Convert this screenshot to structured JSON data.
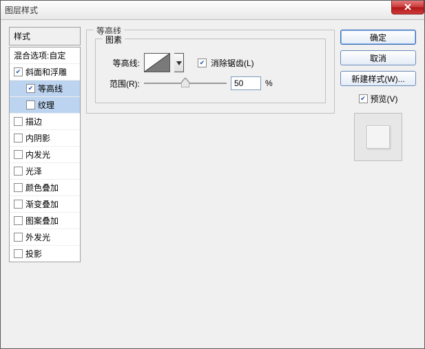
{
  "window": {
    "title": "图层样式"
  },
  "left": {
    "header": "样式",
    "items": [
      {
        "label": "混合选项:自定",
        "checked": null,
        "sub": false,
        "selected": false
      },
      {
        "label": "斜面和浮雕",
        "checked": true,
        "sub": false,
        "selected": false
      },
      {
        "label": "等高线",
        "checked": true,
        "sub": true,
        "selected": true
      },
      {
        "label": "纹理",
        "checked": false,
        "sub": true,
        "selected": true
      },
      {
        "label": "描边",
        "checked": false,
        "sub": false,
        "selected": false
      },
      {
        "label": "内阴影",
        "checked": false,
        "sub": false,
        "selected": false
      },
      {
        "label": "内发光",
        "checked": false,
        "sub": false,
        "selected": false
      },
      {
        "label": "光泽",
        "checked": false,
        "sub": false,
        "selected": false
      },
      {
        "label": "颜色叠加",
        "checked": false,
        "sub": false,
        "selected": false
      },
      {
        "label": "渐变叠加",
        "checked": false,
        "sub": false,
        "selected": false
      },
      {
        "label": "图案叠加",
        "checked": false,
        "sub": false,
        "selected": false
      },
      {
        "label": "外发光",
        "checked": false,
        "sub": false,
        "selected": false
      },
      {
        "label": "投影",
        "checked": false,
        "sub": false,
        "selected": false
      }
    ]
  },
  "center": {
    "outer_legend": "等高线",
    "inner_legend": "图素",
    "contour_label": "等高线:",
    "antialias_checked": true,
    "antialias_label": "消除锯齿(L)",
    "range_label": "范围(R):",
    "range_value": "50",
    "range_percent_pos": 50,
    "pct_label": "%"
  },
  "right": {
    "ok": "确定",
    "cancel": "取消",
    "new_style": "新建样式(W)...",
    "preview_checked": true,
    "preview_label": "预览(V)"
  }
}
